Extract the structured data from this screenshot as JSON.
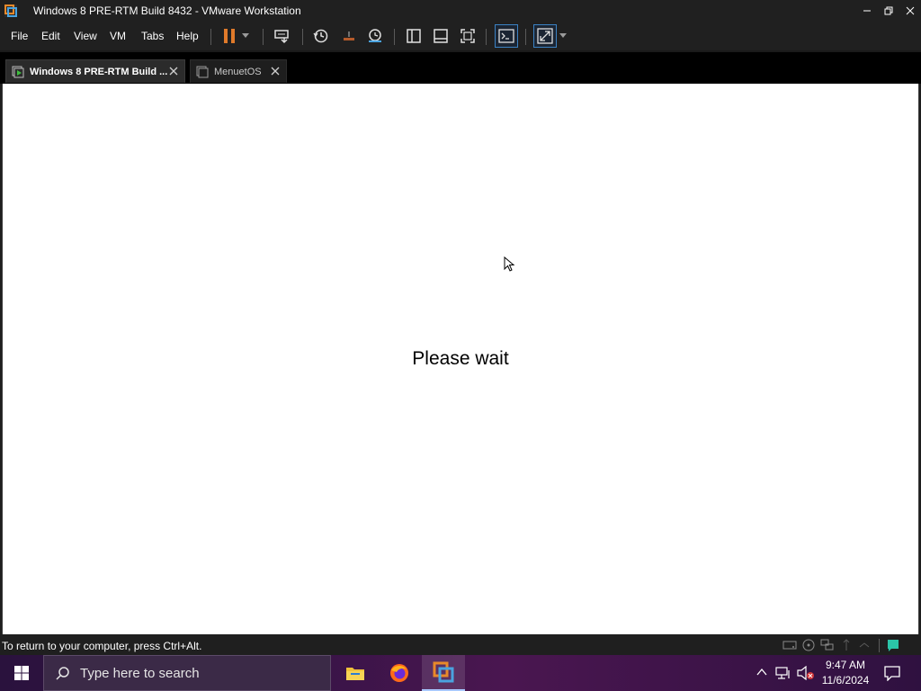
{
  "window": {
    "title": "Windows 8 PRE-RTM Build 8432 - VMware Workstation",
    "controls": [
      "minimize-icon",
      "restore-icon",
      "close-icon"
    ]
  },
  "menubar": {
    "items": [
      {
        "label": "File"
      },
      {
        "label": "Edit"
      },
      {
        "label": "View"
      },
      {
        "label": "VM"
      },
      {
        "label": "Tabs"
      },
      {
        "label": "Help"
      }
    ],
    "toolbar_icons": [
      "pause-icon",
      "dropdown-icon",
      "send-ctrl-alt-del-icon",
      "snapshot-icon",
      "revert-snapshot-icon",
      "snapshot-manager-icon",
      "library-icon",
      "thumbnail-bar-icon",
      "full-screen-icon",
      "console-icon",
      "unity-icon",
      "dropdown-icon"
    ]
  },
  "tabs": [
    {
      "label": "Windows 8 PRE-RTM Build ...",
      "active": true
    },
    {
      "label": "MenuetOS",
      "active": false
    }
  ],
  "vm_screen": {
    "message": "Please wait"
  },
  "statusbar": {
    "message": "To return to your computer, press Ctrl+Alt.",
    "icons": [
      "hard-disk-icon",
      "cd-dvd-icon",
      "network-adapter-icon",
      "usb-icon",
      "sound-icon",
      "display-icon",
      "message-log-icon"
    ]
  },
  "taskbar": {
    "search_placeholder": "Type here to search",
    "apps": [
      "file-explorer-icon",
      "firefox-icon",
      "vmware-workstation-icon"
    ],
    "clock": {
      "time": "9:47 AM",
      "date": "11/6/2024"
    }
  },
  "colors": {
    "chrome": "#202020",
    "tab_strip": "#000000",
    "pause_accent": "#e07a2a",
    "taskbar": "#3a1448"
  }
}
